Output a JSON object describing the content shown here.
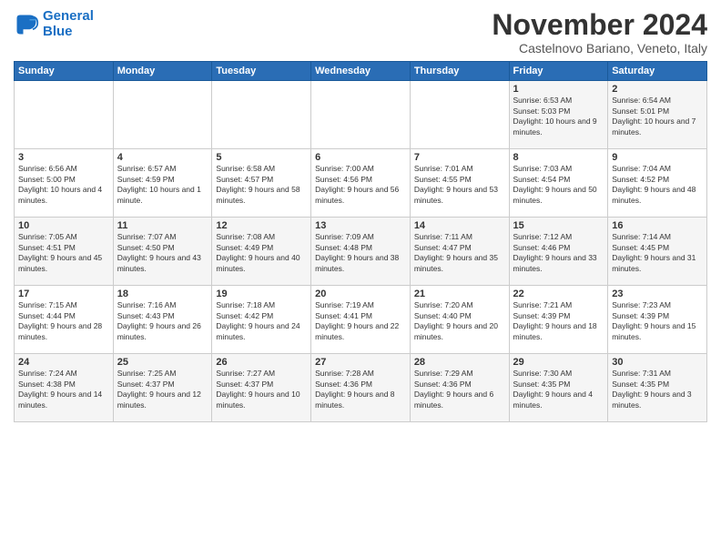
{
  "logo": {
    "line1": "General",
    "line2": "Blue"
  },
  "title": "November 2024",
  "subtitle": "Castelnovo Bariano, Veneto, Italy",
  "days_of_week": [
    "Sunday",
    "Monday",
    "Tuesday",
    "Wednesday",
    "Thursday",
    "Friday",
    "Saturday"
  ],
  "weeks": [
    [
      {
        "day": "",
        "info": ""
      },
      {
        "day": "",
        "info": ""
      },
      {
        "day": "",
        "info": ""
      },
      {
        "day": "",
        "info": ""
      },
      {
        "day": "",
        "info": ""
      },
      {
        "day": "1",
        "info": "Sunrise: 6:53 AM\nSunset: 5:03 PM\nDaylight: 10 hours and 9 minutes."
      },
      {
        "day": "2",
        "info": "Sunrise: 6:54 AM\nSunset: 5:01 PM\nDaylight: 10 hours and 7 minutes."
      }
    ],
    [
      {
        "day": "3",
        "info": "Sunrise: 6:56 AM\nSunset: 5:00 PM\nDaylight: 10 hours and 4 minutes."
      },
      {
        "day": "4",
        "info": "Sunrise: 6:57 AM\nSunset: 4:59 PM\nDaylight: 10 hours and 1 minute."
      },
      {
        "day": "5",
        "info": "Sunrise: 6:58 AM\nSunset: 4:57 PM\nDaylight: 9 hours and 58 minutes."
      },
      {
        "day": "6",
        "info": "Sunrise: 7:00 AM\nSunset: 4:56 PM\nDaylight: 9 hours and 56 minutes."
      },
      {
        "day": "7",
        "info": "Sunrise: 7:01 AM\nSunset: 4:55 PM\nDaylight: 9 hours and 53 minutes."
      },
      {
        "day": "8",
        "info": "Sunrise: 7:03 AM\nSunset: 4:54 PM\nDaylight: 9 hours and 50 minutes."
      },
      {
        "day": "9",
        "info": "Sunrise: 7:04 AM\nSunset: 4:52 PM\nDaylight: 9 hours and 48 minutes."
      }
    ],
    [
      {
        "day": "10",
        "info": "Sunrise: 7:05 AM\nSunset: 4:51 PM\nDaylight: 9 hours and 45 minutes."
      },
      {
        "day": "11",
        "info": "Sunrise: 7:07 AM\nSunset: 4:50 PM\nDaylight: 9 hours and 43 minutes."
      },
      {
        "day": "12",
        "info": "Sunrise: 7:08 AM\nSunset: 4:49 PM\nDaylight: 9 hours and 40 minutes."
      },
      {
        "day": "13",
        "info": "Sunrise: 7:09 AM\nSunset: 4:48 PM\nDaylight: 9 hours and 38 minutes."
      },
      {
        "day": "14",
        "info": "Sunrise: 7:11 AM\nSunset: 4:47 PM\nDaylight: 9 hours and 35 minutes."
      },
      {
        "day": "15",
        "info": "Sunrise: 7:12 AM\nSunset: 4:46 PM\nDaylight: 9 hours and 33 minutes."
      },
      {
        "day": "16",
        "info": "Sunrise: 7:14 AM\nSunset: 4:45 PM\nDaylight: 9 hours and 31 minutes."
      }
    ],
    [
      {
        "day": "17",
        "info": "Sunrise: 7:15 AM\nSunset: 4:44 PM\nDaylight: 9 hours and 28 minutes."
      },
      {
        "day": "18",
        "info": "Sunrise: 7:16 AM\nSunset: 4:43 PM\nDaylight: 9 hours and 26 minutes."
      },
      {
        "day": "19",
        "info": "Sunrise: 7:18 AM\nSunset: 4:42 PM\nDaylight: 9 hours and 24 minutes."
      },
      {
        "day": "20",
        "info": "Sunrise: 7:19 AM\nSunset: 4:41 PM\nDaylight: 9 hours and 22 minutes."
      },
      {
        "day": "21",
        "info": "Sunrise: 7:20 AM\nSunset: 4:40 PM\nDaylight: 9 hours and 20 minutes."
      },
      {
        "day": "22",
        "info": "Sunrise: 7:21 AM\nSunset: 4:39 PM\nDaylight: 9 hours and 18 minutes."
      },
      {
        "day": "23",
        "info": "Sunrise: 7:23 AM\nSunset: 4:39 PM\nDaylight: 9 hours and 15 minutes."
      }
    ],
    [
      {
        "day": "24",
        "info": "Sunrise: 7:24 AM\nSunset: 4:38 PM\nDaylight: 9 hours and 14 minutes."
      },
      {
        "day": "25",
        "info": "Sunrise: 7:25 AM\nSunset: 4:37 PM\nDaylight: 9 hours and 12 minutes."
      },
      {
        "day": "26",
        "info": "Sunrise: 7:27 AM\nSunset: 4:37 PM\nDaylight: 9 hours and 10 minutes."
      },
      {
        "day": "27",
        "info": "Sunrise: 7:28 AM\nSunset: 4:36 PM\nDaylight: 9 hours and 8 minutes."
      },
      {
        "day": "28",
        "info": "Sunrise: 7:29 AM\nSunset: 4:36 PM\nDaylight: 9 hours and 6 minutes."
      },
      {
        "day": "29",
        "info": "Sunrise: 7:30 AM\nSunset: 4:35 PM\nDaylight: 9 hours and 4 minutes."
      },
      {
        "day": "30",
        "info": "Sunrise: 7:31 AM\nSunset: 4:35 PM\nDaylight: 9 hours and 3 minutes."
      }
    ]
  ]
}
